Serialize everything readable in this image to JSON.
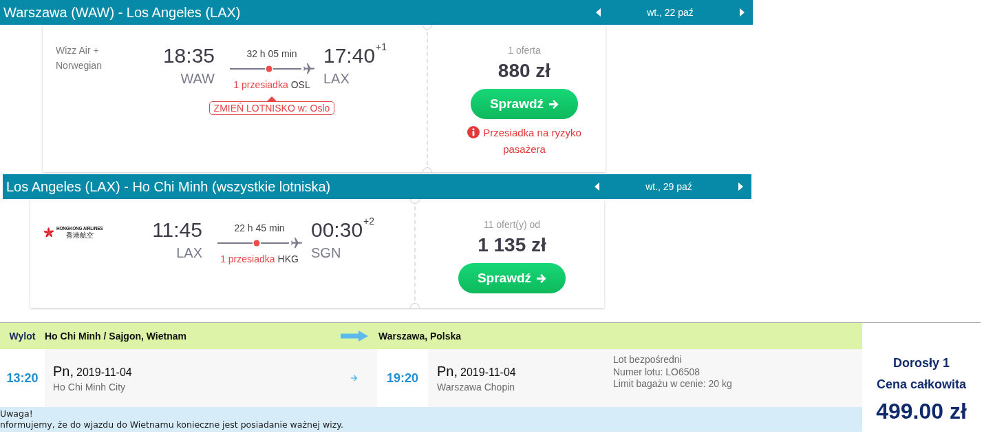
{
  "itineraries": [
    {
      "header": {
        "title": "Warszawa (WAW) - Los Angeles (LAX)",
        "date": "wt., 22 paź"
      },
      "airline": {
        "kind": "text",
        "name": "Wizz Air + Norwegian"
      },
      "departure": {
        "time": "18:35",
        "airport": "WAW"
      },
      "duration": "32 h 05 min",
      "stops": "1 przesiadka",
      "via": "OSL",
      "arrival": {
        "time": "17:40",
        "day_offset": "+1",
        "airport": "LAX"
      },
      "airport_change": "ZMIEŃ LOTNISKO w: Oslo",
      "offers": "1 oferta",
      "price": "880 zł",
      "button": "Sprawdź",
      "warning": "Przesiadka na ryzyko pasażera"
    },
    {
      "header": {
        "title": "Los Angeles (LAX) - Ho Chi Minh (wszystkie lotniska)",
        "date": "wt., 29 paź"
      },
      "airline": {
        "kind": "logo",
        "name": "HONGKONG AIRLINES",
        "name_local": "香港航空"
      },
      "departure": {
        "time": "11:45",
        "airport": "LAX"
      },
      "duration": "22 h 45 min",
      "stops": "1 przesiadka",
      "via": "HKG",
      "arrival": {
        "time": "00:30",
        "day_offset": "+2",
        "airport": "SGN"
      },
      "offers": "11 ofert(y) od",
      "price": "1 135 zł",
      "button": "Sprawdź"
    }
  ],
  "booking": {
    "label": "Wylot",
    "from_city": "Ho Chi Minh / Sajgon, Wietnam",
    "to_city": "Warszawa, Polska",
    "departure": {
      "time": "13:20",
      "day": "Pn,",
      "date": "2019-11-04",
      "airport": "Ho Chi Minh City"
    },
    "arrival": {
      "time": "19:20",
      "day": "Pn,",
      "date": "2019-11-04",
      "airport": "Warszawa Chopin"
    },
    "details": [
      "Lot bezpośredni",
      "Numer lotu: LO6508",
      "Limit bagażu w cenie: 20 kg"
    ],
    "notice": {
      "title": "Uwaga!",
      "text": "nformujemy, że do wjazdu do Wietnamu konieczne jest posiadanie ważnej wizy."
    },
    "summary": {
      "passengers": "Dorosły 1",
      "total_label": "Cena całkowita",
      "total": "499.00 zł"
    }
  }
}
